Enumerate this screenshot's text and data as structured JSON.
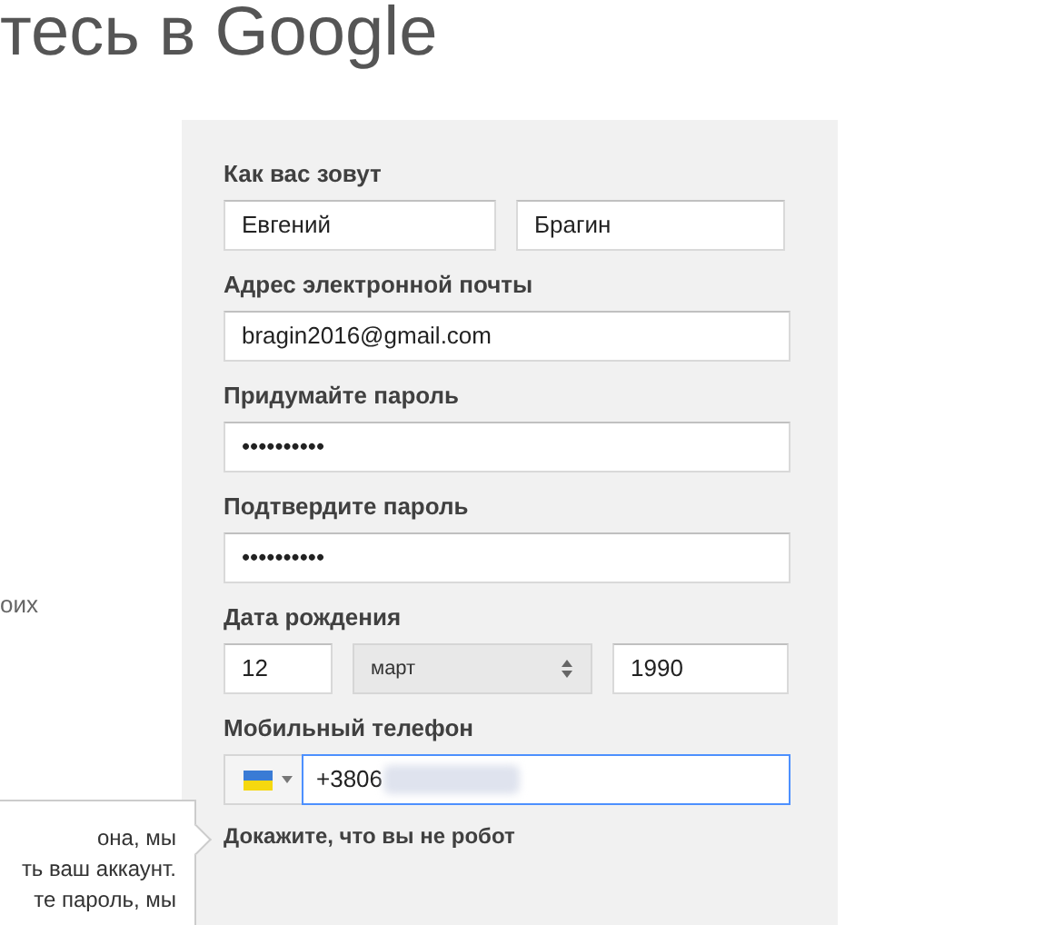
{
  "heading": "тесь в Google",
  "side_text": "оих",
  "tooltip": {
    "lines": [
      "она, мы",
      "ть ваш аккаунт.",
      "те пароль, мы"
    ]
  },
  "form": {
    "name": {
      "label": "Как вас зовут",
      "first": "Евгений",
      "last": "Брагин"
    },
    "email": {
      "label": "Адрес электронной почты",
      "value": "bragin2016@gmail.com"
    },
    "password": {
      "label": "Придумайте пароль",
      "value": "••••••••••"
    },
    "confirm_password": {
      "label": "Подтвердите пароль",
      "value": "••••••••••"
    },
    "birthdate": {
      "label": "Дата рождения",
      "day": "12",
      "month": "март",
      "year": "1990"
    },
    "phone": {
      "label": "Мобильный телефон",
      "value": "+3806",
      "focused": true
    },
    "captcha_label": "Докажите, что вы не робот"
  }
}
